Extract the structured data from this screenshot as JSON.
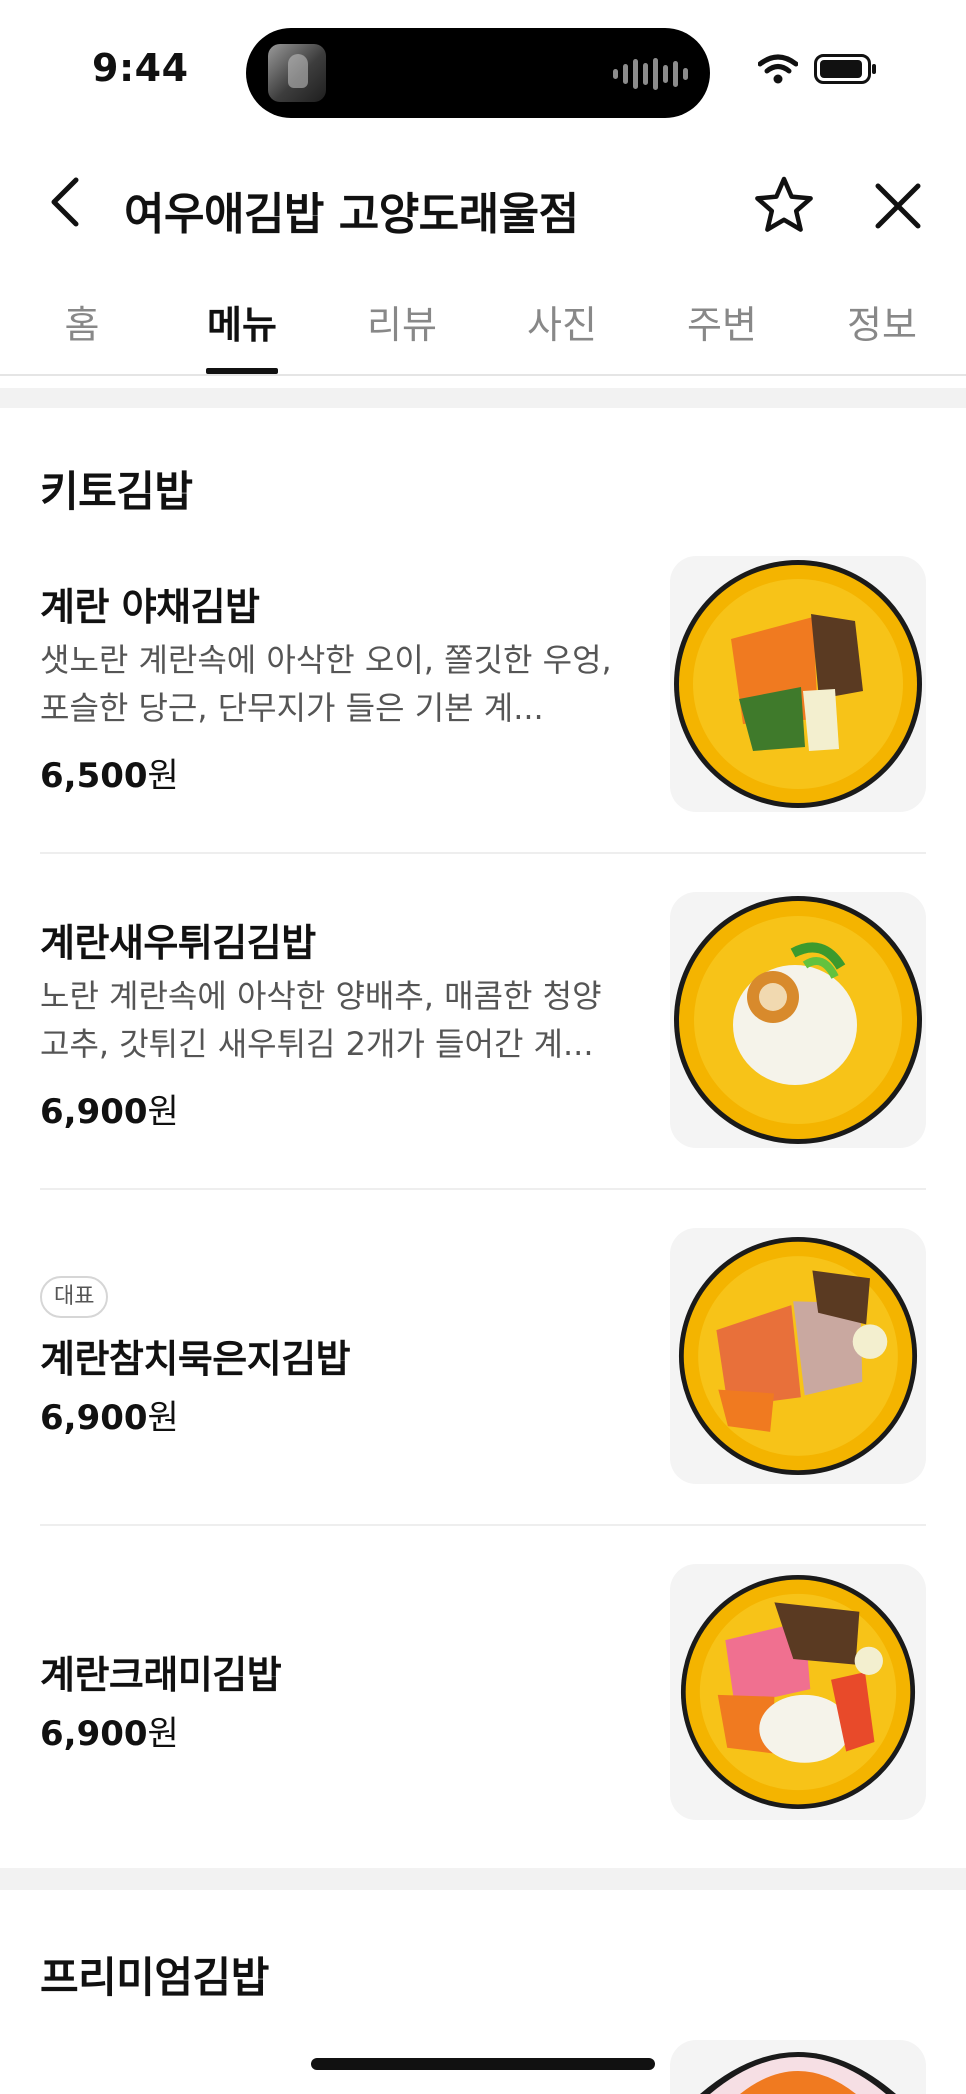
{
  "status_bar": {
    "time": "9:44"
  },
  "header": {
    "title": "여우애김밥 고양도래울점"
  },
  "tabs": [
    {
      "label": "홈",
      "active": false
    },
    {
      "label": "메뉴",
      "active": true
    },
    {
      "label": "리뷰",
      "active": false
    },
    {
      "label": "사진",
      "active": false
    },
    {
      "label": "주변",
      "active": false
    },
    {
      "label": "정보",
      "active": false
    }
  ],
  "sections": [
    {
      "title": "키토김밥",
      "items": [
        {
          "name": "계란 야채김밥",
          "description": "샛노란 계란속에 아삭한 오이, 쫄깃한 우엉, 포슬한 당근, 단무지가 들은 기본 계...",
          "price_number": "6,500",
          "price_unit": "원",
          "image_icon": "gimbap-icon"
        },
        {
          "name": "계란새우튀김김밥",
          "description": "노란 계란속에 아삭한 양배추, 매콤한 청양고추, 갓튀긴 새우튀김 2개가 들어간 계...",
          "price_number": "6,900",
          "price_unit": "원",
          "image_icon": "gimbap-icon"
        },
        {
          "badge": "대표",
          "name": "계란참치묵은지김밥",
          "price_number": "6,900",
          "price_unit": "원",
          "image_icon": "gimbap-icon"
        },
        {
          "name": "계란크래미김밥",
          "price_number": "6,900",
          "price_unit": "원",
          "image_icon": "gimbap-icon"
        }
      ]
    },
    {
      "title": "프리미엄김밥"
    }
  ],
  "colors": {
    "text": "#111111",
    "muted": "#888888",
    "description": "#555555",
    "band": "#f2f2f2",
    "egg": "#f4b400"
  }
}
